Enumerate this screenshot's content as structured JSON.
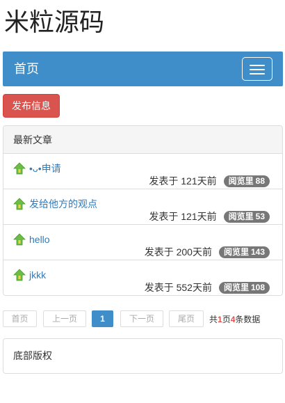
{
  "site": {
    "title": "米粒源码"
  },
  "navbar": {
    "home_label": "首页",
    "bg_color": "#3f8dc9",
    "toggle_icon": "hamburger-menu-icon"
  },
  "publish_button": {
    "label": "发布信息",
    "color": "#d9534f"
  },
  "latest": {
    "heading": "最新文章",
    "articles": [
      {
        "title": "•ᴗ•申请",
        "posted": "发表于 121天前",
        "views_label": "阅览里",
        "views": "88"
      },
      {
        "title": "发给他方的观点",
        "posted": "发表于 121天前",
        "views_label": "阅览里",
        "views": "53"
      },
      {
        "title": "hello",
        "posted": "发表于 200天前",
        "views_label": "阅览里",
        "views": "143"
      },
      {
        "title": "jkkk",
        "posted": "发表于 552天前",
        "views_label": "阅览里",
        "views": "108"
      }
    ]
  },
  "pagination": {
    "first": "首页",
    "prev": "上一页",
    "current": "1",
    "next": "下一页",
    "last": "尾页",
    "summary": {
      "prefix": "共",
      "pages": "1",
      "mid": "页",
      "count": "4",
      "suffix": "条数据"
    }
  },
  "footer": {
    "text": "底部版权"
  }
}
